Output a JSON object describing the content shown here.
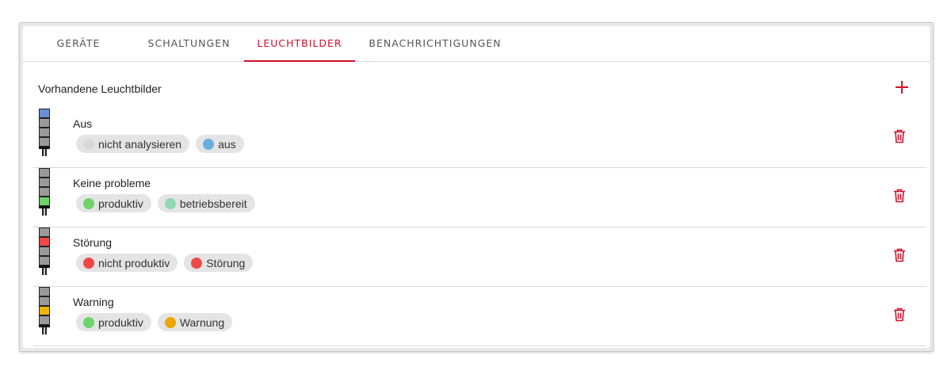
{
  "tabs": [
    {
      "label": "GERÄTE",
      "active": false
    },
    {
      "label": "SCHALTUNGEN",
      "active": false
    },
    {
      "label": "LEUCHTBILDER",
      "active": true
    },
    {
      "label": "BENACHRICHTIGUNGEN",
      "active": false
    }
  ],
  "section": {
    "title": "Vorhandene Leuchtbilder",
    "add_icon": "plus-icon"
  },
  "colors": {
    "accent": "#d0112b",
    "blue": "#6a8fd4",
    "green": "#6dd46a",
    "red": "#f04848",
    "yellow": "#f0b400",
    "lamp_off": "#9a9a9a"
  },
  "items": [
    {
      "title": "Aus",
      "lamp": [
        "blue",
        "off",
        "off",
        "off"
      ],
      "chips": [
        {
          "label": "nicht analysieren",
          "color": "#d8d8d8"
        },
        {
          "label": "aus",
          "color": "#6aaee0"
        }
      ]
    },
    {
      "title": "Keine probleme",
      "lamp": [
        "off",
        "off",
        "off",
        "green"
      ],
      "chips": [
        {
          "label": "produktiv",
          "color": "#6dd46a"
        },
        {
          "label": "betriebsbereit",
          "color": "#8ed9b4"
        }
      ]
    },
    {
      "title": "Störung",
      "lamp": [
        "off",
        "red",
        "off",
        "off"
      ],
      "chips": [
        {
          "label": "nicht produktiv",
          "color": "#f04848"
        },
        {
          "label": "Störung",
          "color": "#f04848"
        }
      ]
    },
    {
      "title": "Warning",
      "lamp": [
        "off",
        "off",
        "yellow",
        "off"
      ],
      "chips": [
        {
          "label": "produktiv",
          "color": "#6dd46a"
        },
        {
          "label": "Warnung",
          "color": "#f0a500"
        }
      ]
    }
  ]
}
